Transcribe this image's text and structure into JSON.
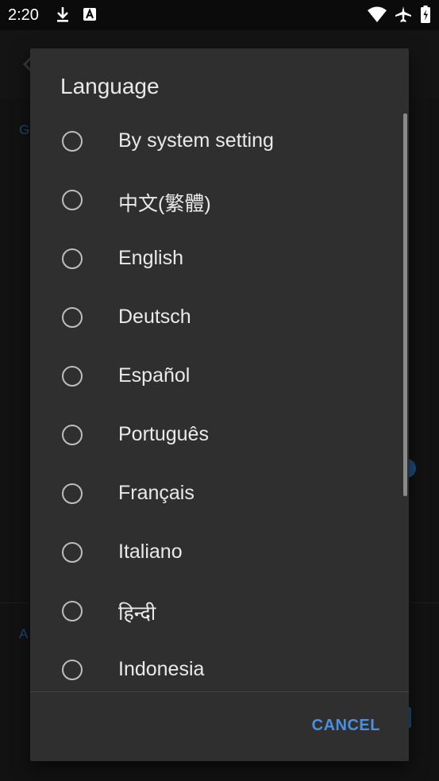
{
  "status_bar": {
    "time": "2:20",
    "icons": [
      "download-icon",
      "a-text-icon",
      "wifi-icon",
      "airplane-icon",
      "battery-icon"
    ]
  },
  "background": {
    "section_label_top": "G",
    "section_label_bottom": "A",
    "accent_color": "#1e4a78"
  },
  "dialog": {
    "title": "Language",
    "options": [
      {
        "label": "By system setting",
        "selected": false
      },
      {
        "label": "中文(繁體)",
        "selected": false
      },
      {
        "label": "English",
        "selected": false
      },
      {
        "label": "Deutsch",
        "selected": false
      },
      {
        "label": "Español",
        "selected": false
      },
      {
        "label": "Português",
        "selected": false
      },
      {
        "label": "Français",
        "selected": false
      },
      {
        "label": "Italiano",
        "selected": false
      },
      {
        "label": "हिन्दी",
        "selected": false
      },
      {
        "label": "Indonesia",
        "selected": false
      }
    ],
    "cancel_label": "CANCEL",
    "accent_color": "#4a90e2"
  }
}
